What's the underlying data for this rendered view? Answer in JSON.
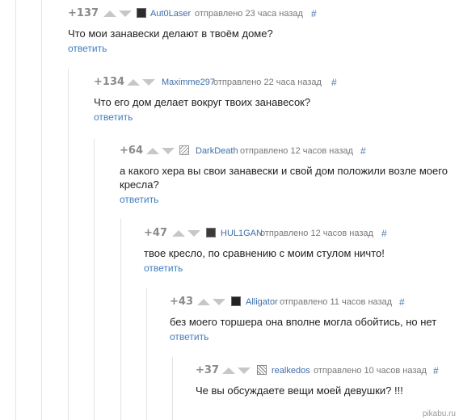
{
  "comments": [
    {
      "rating": "+137",
      "username": "Aut0Laser",
      "posted": "отправлено 23 часа назад",
      "hash": "#",
      "text": "Что мои занавески делают в твоём доме?",
      "reply": "ответить",
      "avatar_icon": "robot-avatar-icon"
    },
    {
      "rating": "+134",
      "username": "Maximme297",
      "posted": "отправлено 22 часа назад",
      "hash": "#",
      "text": "Что его дом делает вокруг твоих занавесок?",
      "reply": "ответить",
      "avatar_icon": ""
    },
    {
      "rating": "+64",
      "username": "DarkDeath",
      "posted": "отправлено 12 часов назад",
      "hash": "#",
      "text": "а какого хера вы свои занавески и свой дом положили возле моего кресла?",
      "reply": "ответить",
      "avatar_icon": "sketch-avatar-icon"
    },
    {
      "rating": "+47",
      "username": "HUL1GAN",
      "posted": "отправлено 12 часов назад",
      "hash": "#",
      "text": "твое кресло, по сравнению с моим стулом ничто!",
      "reply": "ответить",
      "avatar_icon": "dark-avatar-icon"
    },
    {
      "rating": "+43",
      "username": "Alligator",
      "posted": "отправлено 11 часов назад",
      "hash": "#",
      "text": "без моего торшера она вполне могла обойтись, но нет",
      "reply": "ответить",
      "avatar_icon": "dark-avatar-icon"
    },
    {
      "rating": "+37",
      "username": "realkedos",
      "posted": "отправлено 10 часов назад",
      "hash": "#",
      "text": "Че вы обсуждаете вещи моей девушки? !!!",
      "reply": "",
      "avatar_icon": "sketch-avatar-icon"
    }
  ],
  "watermark": "pikabu.ru",
  "colors": {
    "username": "#3f6ea8",
    "reply": "#3f7dbf",
    "rating": "#8a8a8a",
    "thread_line": "#e3e3e3"
  }
}
